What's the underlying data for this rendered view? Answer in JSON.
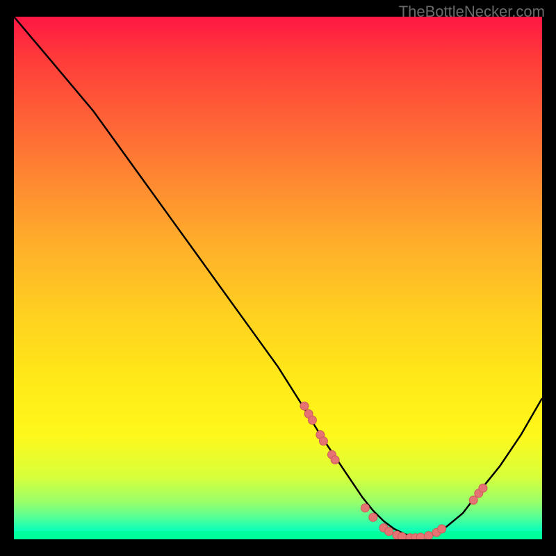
{
  "watermark": "TheBottleNecker.com",
  "chart_data": {
    "type": "line",
    "title": "",
    "xlabel": "",
    "ylabel": "",
    "xlim": [
      0,
      100
    ],
    "ylim": [
      0,
      100
    ],
    "series": [
      {
        "name": "curve",
        "x": [
          0,
          5,
          10,
          15,
          20,
          25,
          30,
          35,
          40,
          45,
          50,
          55,
          58,
          60,
          62,
          64,
          66,
          68,
          70,
          72,
          74,
          76,
          78,
          80,
          82,
          85,
          88,
          92,
          96,
          100
        ],
        "y": [
          100,
          94,
          88,
          82,
          75,
          68,
          61,
          54,
          47,
          40,
          33,
          25,
          20,
          17,
          14,
          11,
          8,
          5.5,
          3.5,
          2,
          1,
          0.5,
          0.5,
          1,
          2.5,
          5,
          9,
          14,
          20,
          27
        ]
      }
    ],
    "markers": [
      {
        "x": 55.0,
        "y": 25.5
      },
      {
        "x": 55.8,
        "y": 24.0
      },
      {
        "x": 56.5,
        "y": 22.8
      },
      {
        "x": 58.0,
        "y": 20.0
      },
      {
        "x": 58.6,
        "y": 18.8
      },
      {
        "x": 60.2,
        "y": 16.2
      },
      {
        "x": 60.8,
        "y": 15.2
      },
      {
        "x": 66.5,
        "y": 6.0
      },
      {
        "x": 68.0,
        "y": 4.2
      },
      {
        "x": 70.0,
        "y": 2.2
      },
      {
        "x": 71.0,
        "y": 1.5
      },
      {
        "x": 72.5,
        "y": 0.8
      },
      {
        "x": 73.5,
        "y": 0.5
      },
      {
        "x": 75.0,
        "y": 0.3
      },
      {
        "x": 76.0,
        "y": 0.3
      },
      {
        "x": 77.0,
        "y": 0.4
      },
      {
        "x": 78.5,
        "y": 0.7
      },
      {
        "x": 80.0,
        "y": 1.3
      },
      {
        "x": 81.0,
        "y": 2.0
      },
      {
        "x": 87.0,
        "y": 7.5
      },
      {
        "x": 88.0,
        "y": 8.8
      },
      {
        "x": 88.8,
        "y": 9.8
      }
    ]
  }
}
